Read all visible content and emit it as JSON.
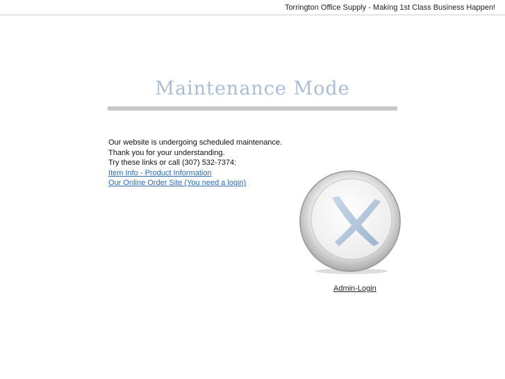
{
  "header": {
    "site_title": "Torrington Office Supply - Making 1st Class Business Happen!"
  },
  "main": {
    "heading": "Maintenance Mode",
    "lines": [
      "Our website is undergoing scheduled maintenance.",
      "Thank you for your understanding.",
      "Try these links or call (307) 532-7374:"
    ],
    "links": [
      "Item Info - Product Information",
      "Our Online Order Site (You need a login)"
    ],
    "admin_login": "Admin-Login"
  },
  "icons": {
    "maintenance_logo": "x-circle-icon"
  },
  "colors": {
    "heading": "#a9bdd4",
    "rule": "#c8c8c8",
    "link": "#2a6ab5",
    "logo_x": "#b7c9dc"
  }
}
